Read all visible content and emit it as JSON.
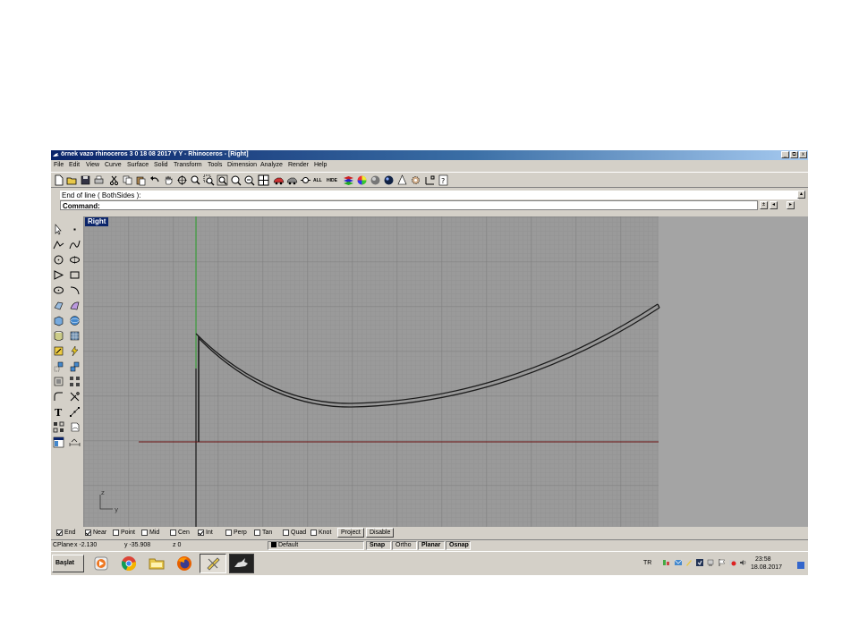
{
  "window": {
    "title": "örnek vazo rhinoceros 3 0 18 08 2017 Y Y - Rhinoceros - [Right]",
    "controls": [
      "_",
      "⧉",
      "x"
    ]
  },
  "menu": [
    "File",
    "Edit",
    "View",
    "Curve",
    "Surface",
    "Solid",
    "Transform",
    "Tools",
    "Dimension",
    "Analyze",
    "Render",
    "Help"
  ],
  "toolbar": {
    "all_label": "ALL",
    "hide_label": "HIDE"
  },
  "command": {
    "history": "End of line ( BothSides ):",
    "prompt": "Command:",
    "value": ""
  },
  "viewport": {
    "name": "Right",
    "axis_z": "z",
    "axis_y": "y"
  },
  "osnap": {
    "items": [
      {
        "label": "End",
        "checked": true
      },
      {
        "label": "Near",
        "checked": true
      },
      {
        "label": "Point",
        "checked": false
      },
      {
        "label": "Mid",
        "checked": false
      },
      {
        "label": "Cen",
        "checked": false
      },
      {
        "label": "Int",
        "checked": true
      },
      {
        "label": "Perp",
        "checked": false
      },
      {
        "label": "Tan",
        "checked": false
      },
      {
        "label": "Quad",
        "checked": false
      },
      {
        "label": "Knot",
        "checked": false
      }
    ],
    "project": "Project",
    "disable": "Disable"
  },
  "status": {
    "cplane": "CPlane",
    "x": "x -2.130",
    "y": "y -35.908",
    "z": "z 0",
    "layer": "Default",
    "snap": "Snap",
    "ortho": "Ortho",
    "planar": "Planar",
    "osnap": "Osnap"
  },
  "taskbar": {
    "start": "Başlat",
    "lang": "TR",
    "time": "23:58",
    "date": "18.08.2017"
  }
}
